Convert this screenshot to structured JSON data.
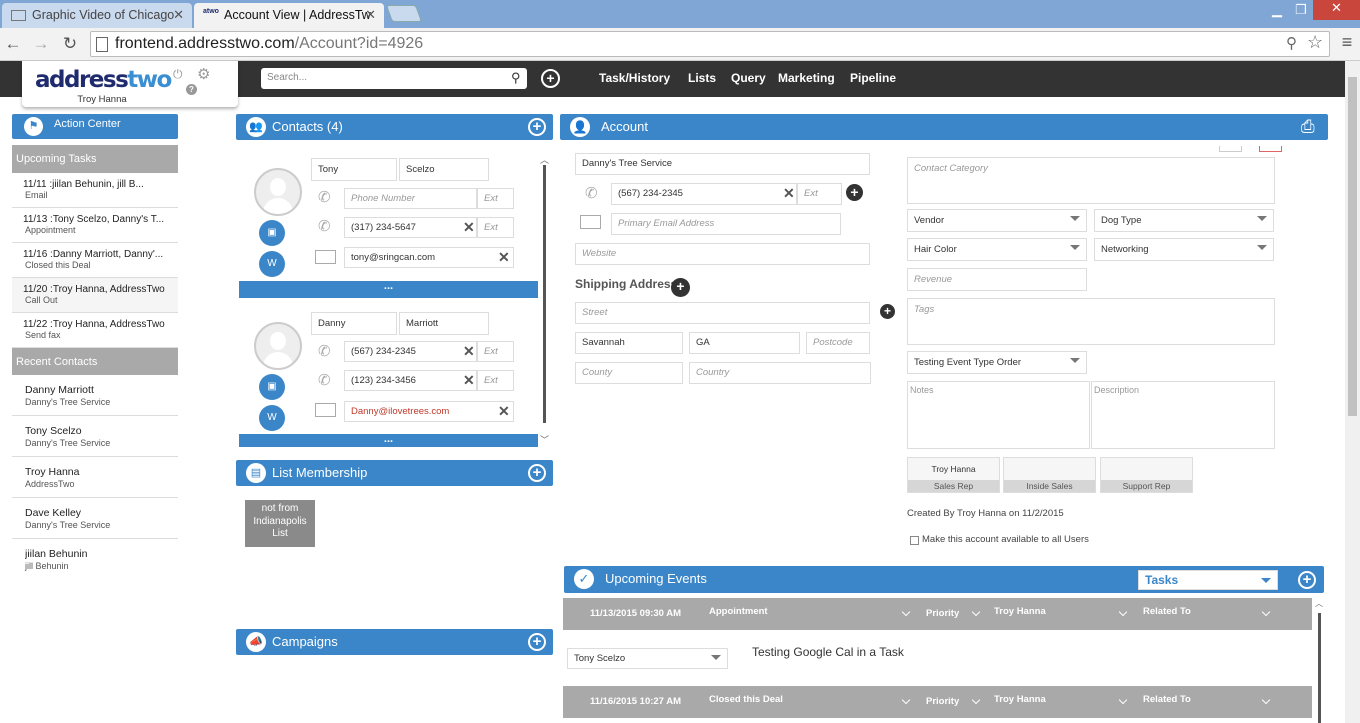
{
  "browser": {
    "tabs": [
      {
        "label": "Graphic Video of Chicago"
      },
      {
        "label": "Account View | AddressTw"
      }
    ],
    "url_host": "frontend.addresstwo.com",
    "url_path": "/Account?id=4926"
  },
  "header": {
    "logo_part1": "address",
    "logo_part2": "two",
    "user_name": "Troy Hanna",
    "search_placeholder": "Search...",
    "nav": [
      "Task/History",
      "Lists",
      "Query",
      "Marketing",
      "Pipeline"
    ]
  },
  "left": {
    "action_center": "Action Center",
    "upcoming_tasks_title": "Upcoming Tasks",
    "tasks": [
      {
        "title": "11/11 :jiilan Behunin, jill B...",
        "type": "Email"
      },
      {
        "title": "11/13 :Tony Scelzo, Danny's T...",
        "type": "Appointment"
      },
      {
        "title": "11/16 :Danny Marriott, Danny'...",
        "type": "Closed this Deal"
      },
      {
        "title": "11/20 :Troy Hanna, AddressTwo",
        "type": "Call Out"
      },
      {
        "title": "11/22 :Troy Hanna, AddressTwo",
        "type": "Send fax"
      }
    ],
    "recent_contacts_title": "Recent Contacts",
    "recent": [
      {
        "name": "Danny Marriott",
        "company": "Danny's Tree Service"
      },
      {
        "name": "Tony Scelzo",
        "company": "Danny's Tree Service"
      },
      {
        "name": "Troy Hanna",
        "company": "AddressTwo"
      },
      {
        "name": "Dave Kelley",
        "company": "Danny's Tree Service"
      },
      {
        "name": "jiilan Behunin",
        "company": "jill Behunin"
      }
    ]
  },
  "contacts": {
    "title": "Contacts (4)",
    "phone_placeholder": "Phone Number",
    "ext_placeholder": "Ext",
    "more": "...",
    "list": [
      {
        "first": "Tony",
        "last": "Scelzo",
        "phone1": "",
        "phone2": "(317) 234-5647",
        "email": "tony@sringcan.com"
      },
      {
        "first": "Danny",
        "last": "Marriott",
        "phone1": "(567) 234-2345",
        "phone2": "(123) 234-3456",
        "email": "Danny@ilovetrees.com"
      }
    ]
  },
  "list_membership": {
    "title": "List Membership",
    "tags": [
      "not from Indianapolis List"
    ]
  },
  "campaigns": {
    "title": "Campaigns"
  },
  "account": {
    "title": "Account",
    "name": "Danny's Tree Service",
    "phone": "(567) 234-2345",
    "ext_placeholder": "Ext",
    "email_placeholder": "Primary Email Address",
    "website_placeholder": "Website",
    "shipping_title": "Shipping Address",
    "street_placeholder": "Street",
    "city": "Savannah",
    "state": "GA",
    "postcode_placeholder": "Postcode",
    "county_placeholder": "County",
    "country_placeholder": "Country",
    "contact_category_placeholder": "Contact Category",
    "selects": {
      "vendor": "Vendor",
      "dog_type": "Dog Type",
      "hair_color": "Hair Color",
      "networking": "Networking",
      "event_type": "Testing Event Type Order"
    },
    "revenue_placeholder": "Revenue",
    "tags_placeholder": "Tags",
    "notes_placeholder": "Notes",
    "description_placeholder": "Description",
    "reps": [
      {
        "name": "Troy Hanna",
        "role": "Sales Rep"
      },
      {
        "name": "",
        "role": "Inside Sales"
      },
      {
        "name": "",
        "role": "Support Rep"
      }
    ],
    "created_by": "Created By Troy Hanna on 11/2/2015",
    "available_all": "Make this account available to all Users"
  },
  "events": {
    "title": "Upcoming Events",
    "filter": "Tasks",
    "rows": [
      {
        "date": "11/13/2015 09:30 AM",
        "type": "Appointment",
        "priority": "Priority",
        "owner": "Troy Hanna",
        "related": "Related To",
        "contact": "Tony Scelzo",
        "description": "Testing Google Cal in a Task"
      },
      {
        "date": "11/16/2015 10:27 AM",
        "type": "Closed this Deal",
        "priority": "Priority",
        "owner": "Troy Hanna",
        "related": "Related To"
      }
    ]
  },
  "colors": {
    "accent": "#3a86c8",
    "header": "#333333",
    "grey": "#a9a9a9",
    "brand_dark": "#1f2b6e"
  }
}
